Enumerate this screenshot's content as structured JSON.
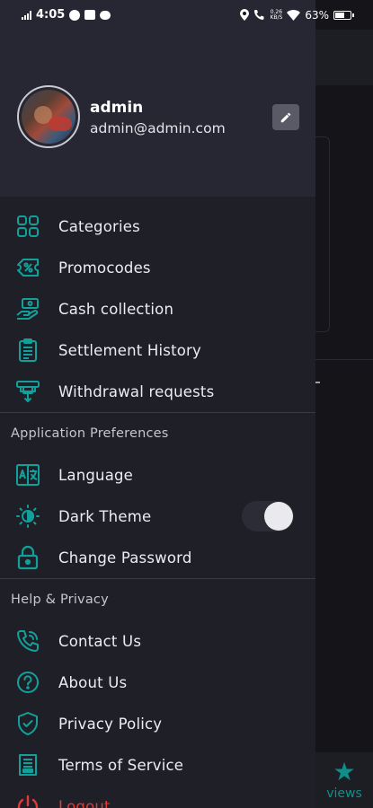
{
  "status_bar": {
    "time": "4:05",
    "net_speed_top": "0.26",
    "net_speed_bottom": "KB/S",
    "battery": "63%"
  },
  "colors": {
    "accent_teal": "#12a19a",
    "logout_red": "#e23a34",
    "drawer_bg": "#1f1f27",
    "header_bg": "#272733"
  },
  "profile": {
    "name": "admin",
    "email": "admin@admin.com",
    "edit_icon": "pencil-icon"
  },
  "menu": {
    "main_items": [
      {
        "label": "Categories",
        "icon": "grid-icon"
      },
      {
        "label": "Promocodes",
        "icon": "promo-ticket-icon"
      },
      {
        "label": "Cash collection",
        "icon": "cash-hand-icon"
      },
      {
        "label": "Settlement History",
        "icon": "clipboard-list-icon"
      },
      {
        "label": "Withdrawal requests",
        "icon": "withdraw-icon"
      }
    ],
    "preferences_title": "Application Preferences",
    "preferences_items": [
      {
        "label": "Language",
        "icon": "translate-icon"
      },
      {
        "label": "Dark Theme",
        "icon": "theme-icon",
        "toggle": true
      },
      {
        "label": "Change Password",
        "icon": "lock-icon"
      }
    ],
    "help_title": "Help & Privacy",
    "help_items": [
      {
        "label": "Contact Us",
        "icon": "phone-icon"
      },
      {
        "label": "About Us",
        "icon": "question-circle-icon"
      },
      {
        "label": "Privacy Policy",
        "icon": "shield-check-icon"
      },
      {
        "label": "Terms of Service",
        "icon": "document-icon"
      },
      {
        "label": "Logout",
        "icon": "power-icon"
      }
    ]
  },
  "background_app": {
    "bottom_nav_label": "views",
    "bottom_nav_icon": "star-icon"
  }
}
